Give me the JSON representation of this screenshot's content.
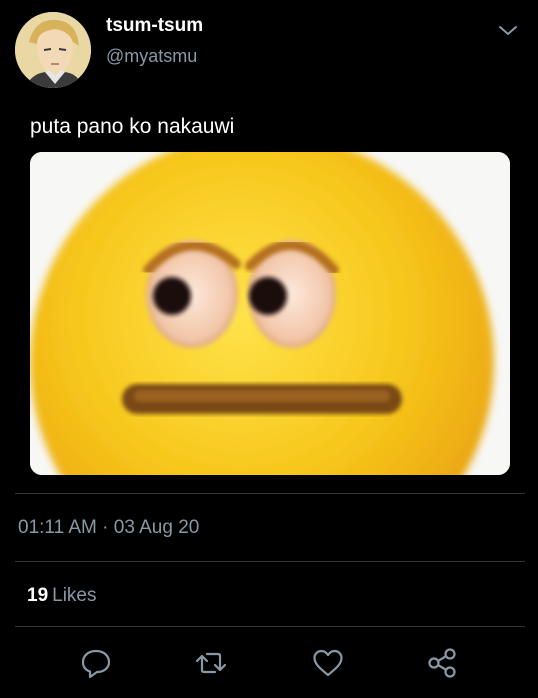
{
  "tweet": {
    "display_name": "tsum-tsum",
    "handle": "@myatsmu",
    "text": "puta pano ko nakauwi",
    "timestamp": "01:11 AM · 03 Aug 20",
    "likes_count": "19",
    "likes_label": "Likes"
  },
  "icons": {
    "menu": "chevron-down-icon",
    "reply": "reply-bubble-icon",
    "retweet": "retweet-icon",
    "like": "heart-icon",
    "share": "share-icon"
  },
  "colors": {
    "background": "#000000",
    "text_primary": "#ffffff",
    "text_secondary": "#8899a6",
    "divider": "#2f3336",
    "emoji_yellow": "#f5c518"
  }
}
